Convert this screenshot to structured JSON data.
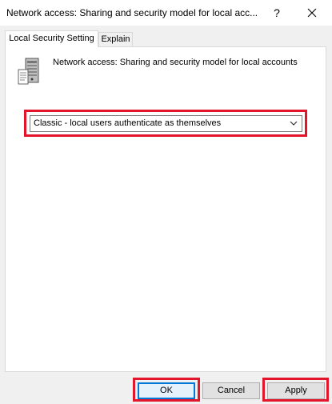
{
  "dialog": {
    "title": "Network access: Sharing and security model for local acc...",
    "help_label": "?"
  },
  "tabs": [
    {
      "label": "Local Security Setting",
      "active": true
    },
    {
      "label": "Explain",
      "active": false
    }
  ],
  "policy": {
    "name": "Network access: Sharing and security model for local accounts",
    "icon": "server-policy-icon"
  },
  "setting": {
    "selected": "Classic - local users authenticate as themselves"
  },
  "buttons": {
    "ok": "OK",
    "cancel": "Cancel",
    "apply": "Apply"
  },
  "colors": {
    "highlight": "#e3152a",
    "focus": "#0078d7"
  }
}
